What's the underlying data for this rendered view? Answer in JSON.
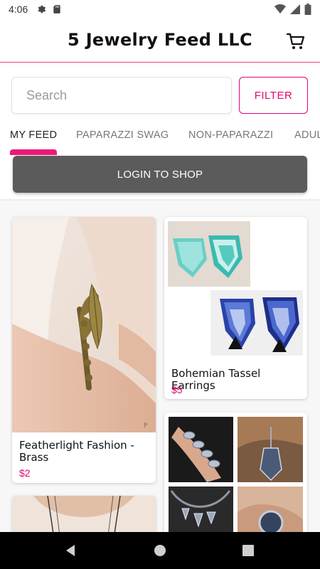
{
  "status_bar": {
    "time": "4:06",
    "icons": [
      "settings-icon",
      "sd-card-icon",
      "wifi-icon",
      "signal-icon",
      "battery-icon"
    ]
  },
  "app_bar": {
    "title": "5 Jewelry Feed LLC",
    "cart_icon": "cart-icon"
  },
  "search": {
    "placeholder": "Search",
    "value": ""
  },
  "filter": {
    "label": "FILTER"
  },
  "tabs": [
    {
      "label": "MY FEED",
      "active": true
    },
    {
      "label": "PAPARAZZI SWAG",
      "active": false
    },
    {
      "label": "NON-PAPARAZZI",
      "active": false
    },
    {
      "label": "ADULT",
      "active": false
    }
  ],
  "login": {
    "label": "LOGIN TO SHOP"
  },
  "products": [
    {
      "title": "Featherlight Fashion - Brass",
      "price": "$2"
    },
    {
      "title": "Bohemian Tassel Earrings",
      "price": "$5"
    }
  ],
  "colors": {
    "accent": "#e3066f",
    "tab_indicator": "#ec1a7b",
    "login_button": "#5b5b5b"
  },
  "nav_bar": {
    "icons": [
      "back-icon",
      "home-icon",
      "recents-icon"
    ]
  }
}
